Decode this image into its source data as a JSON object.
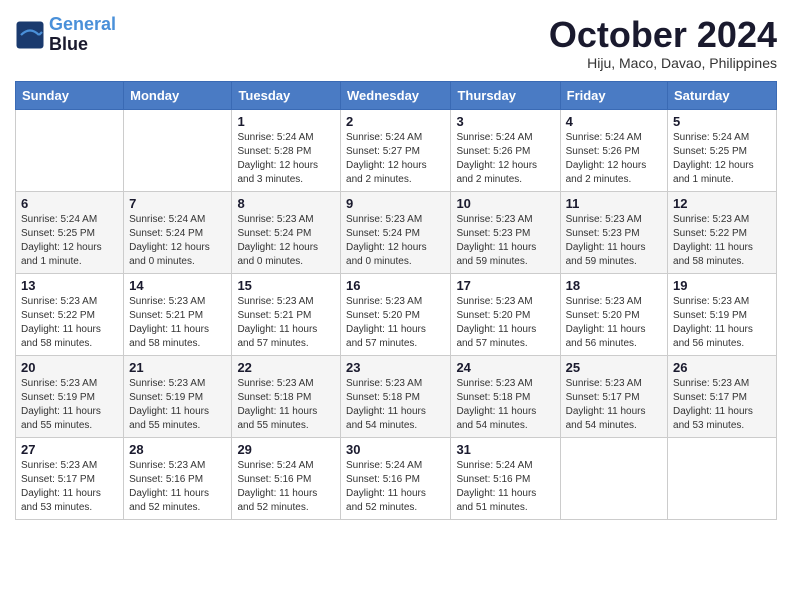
{
  "header": {
    "logo_line1": "General",
    "logo_line2": "Blue",
    "month_title": "October 2024",
    "location": "Hiju, Maco, Davao, Philippines"
  },
  "days_of_week": [
    "Sunday",
    "Monday",
    "Tuesday",
    "Wednesday",
    "Thursday",
    "Friday",
    "Saturday"
  ],
  "weeks": [
    {
      "style": "white",
      "days": [
        {
          "num": "",
          "info": ""
        },
        {
          "num": "",
          "info": ""
        },
        {
          "num": "1",
          "info": "Sunrise: 5:24 AM\nSunset: 5:28 PM\nDaylight: 12 hours\nand 3 minutes."
        },
        {
          "num": "2",
          "info": "Sunrise: 5:24 AM\nSunset: 5:27 PM\nDaylight: 12 hours\nand 2 minutes."
        },
        {
          "num": "3",
          "info": "Sunrise: 5:24 AM\nSunset: 5:26 PM\nDaylight: 12 hours\nand 2 minutes."
        },
        {
          "num": "4",
          "info": "Sunrise: 5:24 AM\nSunset: 5:26 PM\nDaylight: 12 hours\nand 2 minutes."
        },
        {
          "num": "5",
          "info": "Sunrise: 5:24 AM\nSunset: 5:25 PM\nDaylight: 12 hours\nand 1 minute."
        }
      ]
    },
    {
      "style": "gray",
      "days": [
        {
          "num": "6",
          "info": "Sunrise: 5:24 AM\nSunset: 5:25 PM\nDaylight: 12 hours\nand 1 minute."
        },
        {
          "num": "7",
          "info": "Sunrise: 5:24 AM\nSunset: 5:24 PM\nDaylight: 12 hours\nand 0 minutes."
        },
        {
          "num": "8",
          "info": "Sunrise: 5:23 AM\nSunset: 5:24 PM\nDaylight: 12 hours\nand 0 minutes."
        },
        {
          "num": "9",
          "info": "Sunrise: 5:23 AM\nSunset: 5:24 PM\nDaylight: 12 hours\nand 0 minutes."
        },
        {
          "num": "10",
          "info": "Sunrise: 5:23 AM\nSunset: 5:23 PM\nDaylight: 11 hours\nand 59 minutes."
        },
        {
          "num": "11",
          "info": "Sunrise: 5:23 AM\nSunset: 5:23 PM\nDaylight: 11 hours\nand 59 minutes."
        },
        {
          "num": "12",
          "info": "Sunrise: 5:23 AM\nSunset: 5:22 PM\nDaylight: 11 hours\nand 58 minutes."
        }
      ]
    },
    {
      "style": "white",
      "days": [
        {
          "num": "13",
          "info": "Sunrise: 5:23 AM\nSunset: 5:22 PM\nDaylight: 11 hours\nand 58 minutes."
        },
        {
          "num": "14",
          "info": "Sunrise: 5:23 AM\nSunset: 5:21 PM\nDaylight: 11 hours\nand 58 minutes."
        },
        {
          "num": "15",
          "info": "Sunrise: 5:23 AM\nSunset: 5:21 PM\nDaylight: 11 hours\nand 57 minutes."
        },
        {
          "num": "16",
          "info": "Sunrise: 5:23 AM\nSunset: 5:20 PM\nDaylight: 11 hours\nand 57 minutes."
        },
        {
          "num": "17",
          "info": "Sunrise: 5:23 AM\nSunset: 5:20 PM\nDaylight: 11 hours\nand 57 minutes."
        },
        {
          "num": "18",
          "info": "Sunrise: 5:23 AM\nSunset: 5:20 PM\nDaylight: 11 hours\nand 56 minutes."
        },
        {
          "num": "19",
          "info": "Sunrise: 5:23 AM\nSunset: 5:19 PM\nDaylight: 11 hours\nand 56 minutes."
        }
      ]
    },
    {
      "style": "gray",
      "days": [
        {
          "num": "20",
          "info": "Sunrise: 5:23 AM\nSunset: 5:19 PM\nDaylight: 11 hours\nand 55 minutes."
        },
        {
          "num": "21",
          "info": "Sunrise: 5:23 AM\nSunset: 5:19 PM\nDaylight: 11 hours\nand 55 minutes."
        },
        {
          "num": "22",
          "info": "Sunrise: 5:23 AM\nSunset: 5:18 PM\nDaylight: 11 hours\nand 55 minutes."
        },
        {
          "num": "23",
          "info": "Sunrise: 5:23 AM\nSunset: 5:18 PM\nDaylight: 11 hours\nand 54 minutes."
        },
        {
          "num": "24",
          "info": "Sunrise: 5:23 AM\nSunset: 5:18 PM\nDaylight: 11 hours\nand 54 minutes."
        },
        {
          "num": "25",
          "info": "Sunrise: 5:23 AM\nSunset: 5:17 PM\nDaylight: 11 hours\nand 54 minutes."
        },
        {
          "num": "26",
          "info": "Sunrise: 5:23 AM\nSunset: 5:17 PM\nDaylight: 11 hours\nand 53 minutes."
        }
      ]
    },
    {
      "style": "white",
      "days": [
        {
          "num": "27",
          "info": "Sunrise: 5:23 AM\nSunset: 5:17 PM\nDaylight: 11 hours\nand 53 minutes."
        },
        {
          "num": "28",
          "info": "Sunrise: 5:23 AM\nSunset: 5:16 PM\nDaylight: 11 hours\nand 52 minutes."
        },
        {
          "num": "29",
          "info": "Sunrise: 5:24 AM\nSunset: 5:16 PM\nDaylight: 11 hours\nand 52 minutes."
        },
        {
          "num": "30",
          "info": "Sunrise: 5:24 AM\nSunset: 5:16 PM\nDaylight: 11 hours\nand 52 minutes."
        },
        {
          "num": "31",
          "info": "Sunrise: 5:24 AM\nSunset: 5:16 PM\nDaylight: 11 hours\nand 51 minutes."
        },
        {
          "num": "",
          "info": ""
        },
        {
          "num": "",
          "info": ""
        }
      ]
    }
  ]
}
